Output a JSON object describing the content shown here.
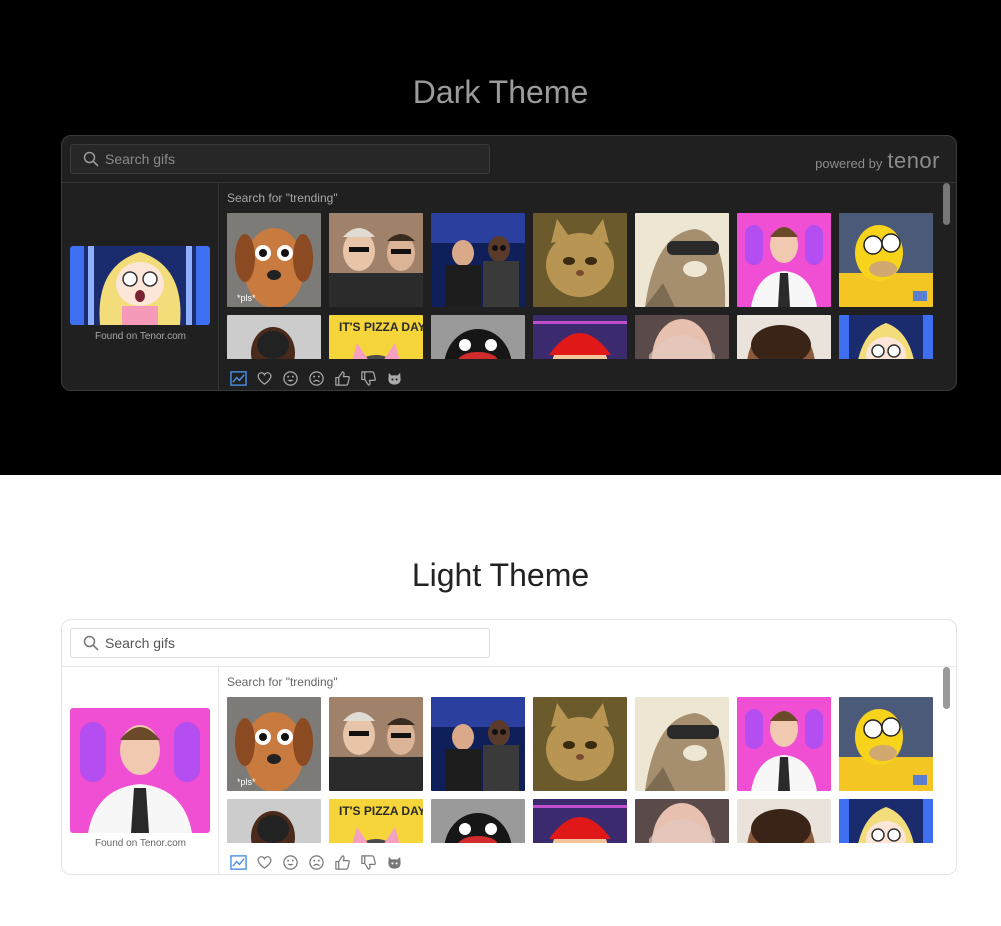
{
  "sections": [
    {
      "theme": "dark",
      "title": "Dark Theme",
      "search": {
        "placeholder": "Search gifs",
        "value": ""
      },
      "powered_by": {
        "prefix": "powered by",
        "brand": "tenor"
      },
      "preview_caption": "Found on Tenor.com",
      "search_label": "Search for \"trending\""
    },
    {
      "theme": "light",
      "title": "Light Theme",
      "search": {
        "placeholder": "Search gifs",
        "value": ""
      },
      "preview_caption": "Found on Tenor.com",
      "search_label": "Search for \"trending\""
    }
  ],
  "gif_tiles": [
    {
      "name": "dog-pls-gif",
      "caption": "*pls*"
    },
    {
      "name": "sunglasses-guys-gif"
    },
    {
      "name": "talk-show-gif"
    },
    {
      "name": "cat-gif"
    },
    {
      "name": "regular-show-gif"
    },
    {
      "name": "woman-tie-gif"
    },
    {
      "name": "homer-simpson-gif"
    },
    {
      "name": "laughing-woman-gif"
    },
    {
      "name": "pizza-day-gif",
      "caption": "IT'S PIZZA DAY!"
    },
    {
      "name": "pingu-gif"
    },
    {
      "name": "mario-gif"
    },
    {
      "name": "blonde-woman-gif"
    },
    {
      "name": "boy-gif"
    },
    {
      "name": "anime-girl-gif"
    }
  ],
  "categories": [
    {
      "name": "trending-icon",
      "active": true
    },
    {
      "name": "heart-icon"
    },
    {
      "name": "smile-icon"
    },
    {
      "name": "sad-icon"
    },
    {
      "name": "thumbs-up-icon"
    },
    {
      "name": "thumbs-down-icon"
    },
    {
      "name": "cat-icon"
    }
  ],
  "colors": {
    "accent": "#4a8fe7",
    "dark_bg": "#000000",
    "dark_panel": "#202020",
    "light_panel": "#ffffff"
  }
}
